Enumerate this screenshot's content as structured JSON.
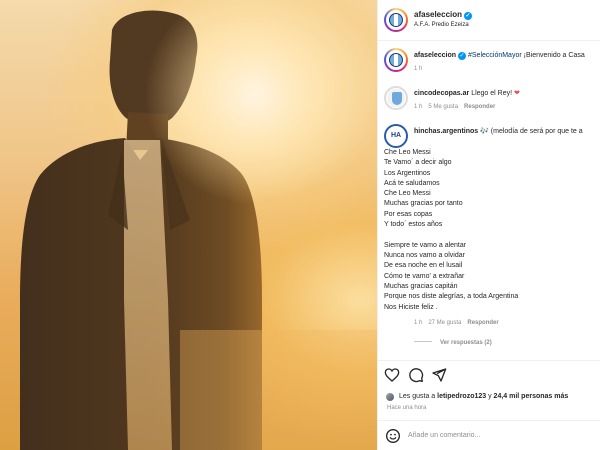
{
  "post": {
    "account": "afaseleccion",
    "location": "A.F.A. Predio Ezeiza"
  },
  "caption": {
    "username": "afaseleccion",
    "hashtag": "#SelecciónMayor",
    "text": " ¡Bienvenido a Casa",
    "time": "1 h"
  },
  "comments": [
    {
      "username": "cincodecopas.ar",
      "text": " Llego el Rey! ",
      "emoji": "❤",
      "time": "1 h",
      "likes": "5 Me gusta",
      "reply": "Responder"
    },
    {
      "username": "hinchas.argentinos",
      "emoji": "🎶",
      "text": " (melodía de será por que te a",
      "avatar_text": "HA",
      "time": "1 h",
      "likes": "27 Me gusta",
      "reply": "Responder",
      "view_replies": "Ver respuestas (2)",
      "lyrics_a": [
        "Che Leo Messi",
        "Te Vamo´ a decir algo",
        "Los Argentinos",
        "Acá te saludamos",
        "Che Leo Messi",
        "Muchas gracias por tanto",
        "Por esas copas",
        "Y todo´ estos años"
      ],
      "lyrics_b": [
        "Siempre te vamo a alentar",
        "Nunca nos vamo a olvidar",
        "De esa noche en el lusail",
        "Cómo te vamo' a extrañar",
        "Muchas gracias capitán",
        "Porque nos diste alegrías, a toda Argentina",
        "Nos Hiciste feliz ."
      ]
    }
  ],
  "actions": {
    "like_icon": "heart-icon",
    "comment_icon": "comment-icon",
    "share_icon": "share-icon"
  },
  "likes_line": {
    "prefix": "Les gusta a ",
    "user": "letipedrozo123",
    "middle": " y ",
    "count": "24,4 mil personas más"
  },
  "posted": "Hace una hora",
  "add_comment": {
    "placeholder": "Añade un comentario...",
    "icon": "emoji-icon"
  },
  "colors": {
    "accent": "#0095f6",
    "hashtag": "#00376b",
    "heart": "#ed4956",
    "muted": "#8e8e8e"
  }
}
